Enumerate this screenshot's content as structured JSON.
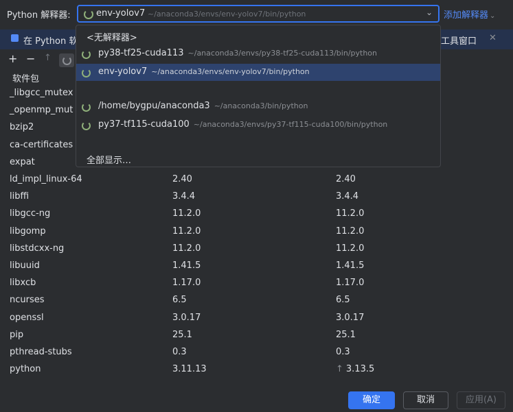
{
  "header": {
    "interpreter_label": "Python 解释器:",
    "selected_name": "env-yolov7",
    "selected_path": "~/anaconda3/envs/env-yolov7/bin/python",
    "add_interpreter": "添加解释器"
  },
  "banner": {
    "text": "在 Python 软",
    "right_text": "工具窗口",
    "close": "✕"
  },
  "toolbar": {
    "add": "+",
    "remove": "−",
    "upgrade": "↑"
  },
  "table": {
    "column_header": "软件包",
    "rows": [
      {
        "name": "_libgcc_mutex",
        "version": "",
        "latest": ""
      },
      {
        "name": "_openmp_mut",
        "version": "",
        "latest": ""
      },
      {
        "name": "bzip2",
        "version": "",
        "latest": ""
      },
      {
        "name": "ca-certificates",
        "version": "",
        "latest": ""
      },
      {
        "name": "expat",
        "version": "",
        "latest": ""
      },
      {
        "name": "ld_impl_linux-64",
        "version": "2.40",
        "latest": "2.40"
      },
      {
        "name": "libffi",
        "version": "3.4.4",
        "latest": "3.4.4"
      },
      {
        "name": "libgcc-ng",
        "version": "11.2.0",
        "latest": "11.2.0"
      },
      {
        "name": "libgomp",
        "version": "11.2.0",
        "latest": "11.2.0"
      },
      {
        "name": "libstdcxx-ng",
        "version": "11.2.0",
        "latest": "11.2.0"
      },
      {
        "name": "libuuid",
        "version": "1.41.5",
        "latest": "1.41.5"
      },
      {
        "name": "libxcb",
        "version": "1.17.0",
        "latest": "1.17.0"
      },
      {
        "name": "ncurses",
        "version": "6.5",
        "latest": "6.5"
      },
      {
        "name": "openssl",
        "version": "3.0.17",
        "latest": "3.0.17"
      },
      {
        "name": "pip",
        "version": "25.1",
        "latest": "25.1"
      },
      {
        "name": "pthread-stubs",
        "version": "0.3",
        "latest": "0.3"
      },
      {
        "name": "python",
        "version": "3.11.13",
        "latest": "3.13.5",
        "upgrade_arrow": "↑"
      }
    ]
  },
  "dropdown": {
    "no_interpreter": "<无解释器>",
    "items": [
      {
        "name": "py38-tf25-cuda113",
        "path": "~/anaconda3/envs/py38-tf25-cuda113/bin/python"
      },
      {
        "name": "env-yolov7",
        "path": "~/anaconda3/envs/env-yolov7/bin/python"
      },
      {
        "name": "/home/bygpu/anaconda3",
        "path": "~/anaconda3/bin/python"
      },
      {
        "name": "py37-tf115-cuda100",
        "path": "~/anaconda3/envs/py37-tf115-cuda100/bin/python"
      }
    ],
    "show_all": "全部显示…"
  },
  "buttons": {
    "ok": "确定",
    "cancel": "取消",
    "apply": "应用(A)"
  },
  "colors": {
    "accent": "#3574f0",
    "link": "#548af7",
    "background": "#2b2d30",
    "selection": "#2e436e"
  }
}
